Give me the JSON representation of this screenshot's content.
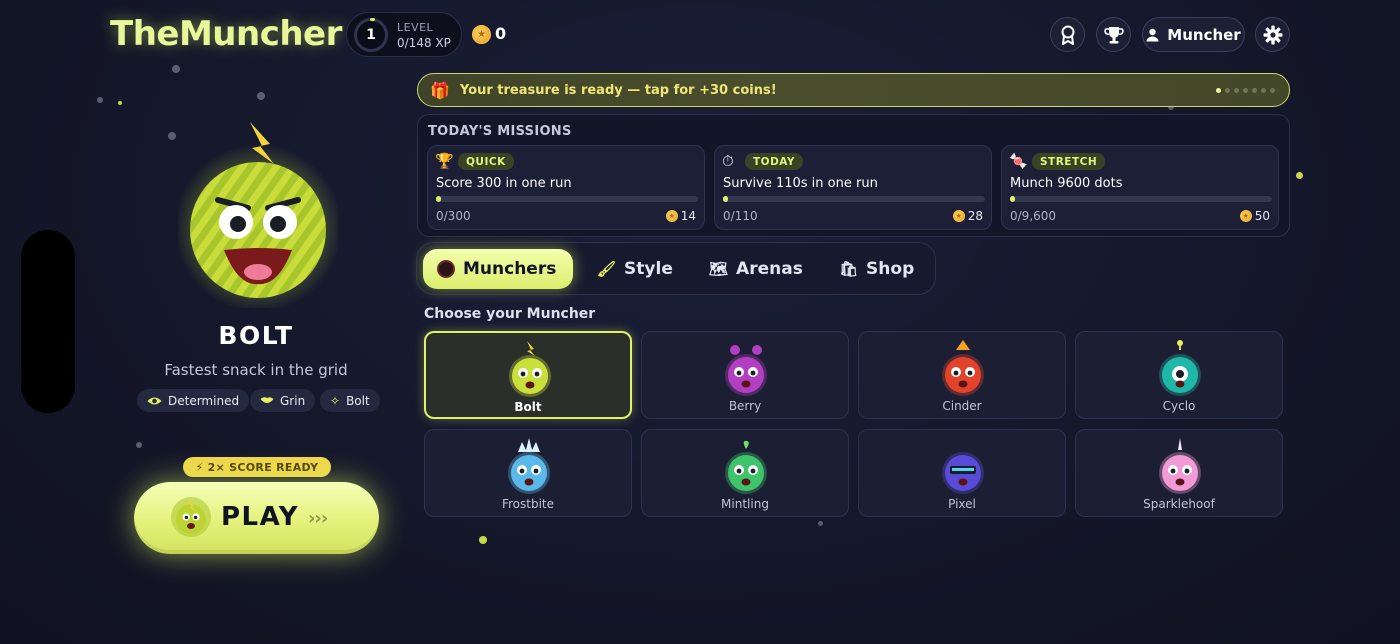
{
  "app": {
    "title": "TheMuncher"
  },
  "level": {
    "label": "LEVEL",
    "number": "1",
    "xp": "0/148 XP"
  },
  "coins": {
    "count": "0"
  },
  "header_buttons": {
    "achievements_icon": "ribbon-award-icon",
    "leaderboard_icon": "trophy-icon",
    "profile_label": "Muncher",
    "settings_icon": "gear-icon"
  },
  "hero": {
    "name": "BOLT",
    "tagline": "Fastest snack in the grid",
    "traits": [
      {
        "label": "Determined",
        "icon": "eye-icon"
      },
      {
        "label": "Grin",
        "icon": "lips-icon"
      },
      {
        "label": "Bolt",
        "icon": "sparkle-icon"
      }
    ]
  },
  "play": {
    "badge": "2× SCORE READY",
    "label": "PLAY",
    "arrows": "›››"
  },
  "treasure": {
    "text": "Your treasure is ready — tap for +30 coins!",
    "icon": "gift-icon"
  },
  "missions": {
    "title": "TODAY'S MISSIONS",
    "items": [
      {
        "badge": "QUICK",
        "icon": "trophy-icon",
        "text": "Score 300 in one run",
        "progress": "0/300",
        "reward": "14",
        "fraction": 0.0
      },
      {
        "badge": "TODAY",
        "icon": "stopwatch-icon",
        "text": "Survive 110s in one run",
        "progress": "0/110",
        "reward": "28",
        "fraction": 0.0
      },
      {
        "badge": "STRETCH",
        "icon": "candy-icon",
        "text": "Munch 9600 dots",
        "progress": "0/9,600",
        "reward": "50",
        "fraction": 0.0
      }
    ]
  },
  "tabs": [
    {
      "label": "Munchers",
      "icon": "muncher-icon",
      "active": true
    },
    {
      "label": "Style",
      "icon": "brush-icon",
      "active": false
    },
    {
      "label": "Arenas",
      "icon": "map-icon",
      "active": false
    },
    {
      "label": "Shop",
      "icon": "shopping-bag-icon",
      "active": false
    }
  ],
  "choose": {
    "title": "Choose your Muncher",
    "characters": [
      {
        "name": "Bolt",
        "color": "#c9e03a",
        "selected": true
      },
      {
        "name": "Berry",
        "color": "#b23fc2",
        "selected": false
      },
      {
        "name": "Cinder",
        "color": "#e2432a",
        "selected": false
      },
      {
        "name": "Cyclo",
        "color": "#1fb8a8",
        "selected": false
      },
      {
        "name": "Frostbite",
        "color": "#5ab8ea",
        "selected": false
      },
      {
        "name": "Mintling",
        "color": "#3ec46a",
        "selected": false
      },
      {
        "name": "Pixel",
        "color": "#5a4ad8",
        "selected": false
      },
      {
        "name": "Sparklehoof",
        "color": "#f29ad6",
        "selected": false
      }
    ]
  }
}
